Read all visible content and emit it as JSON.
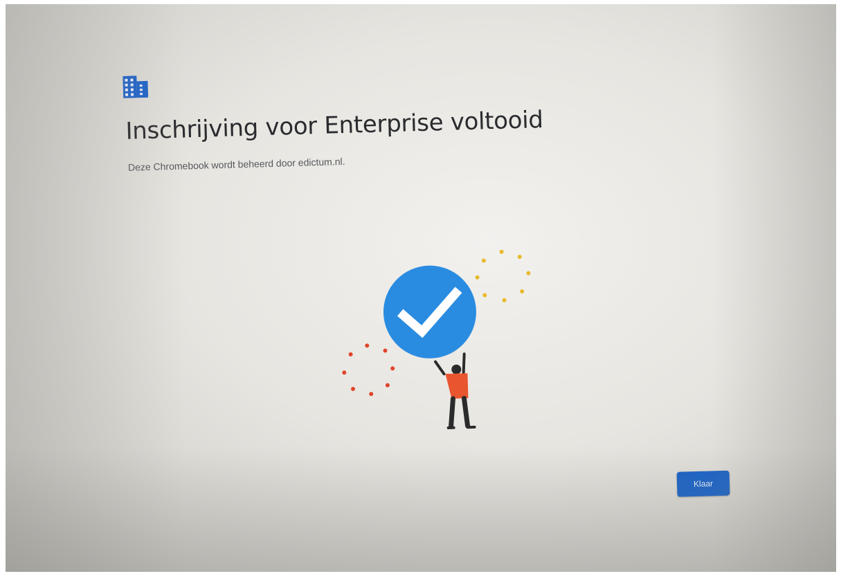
{
  "enrollment": {
    "title": "Inschrijving voor Enterprise voltooid",
    "subtitle": "Deze Chromebook wordt beheerd door edictum.nl."
  },
  "actions": {
    "done_label": "Klaar"
  },
  "icons": {
    "header": "enterprise-building-icon",
    "illustration": "checkmark-badge-person-illustration"
  },
  "colors": {
    "accent_blue": "#1a63c7",
    "check_circle_blue": "#2a8ce0",
    "person_shirt": "#e9552e",
    "confetti_yellow": "#e8b92a",
    "confetti_red": "#e0442c"
  }
}
